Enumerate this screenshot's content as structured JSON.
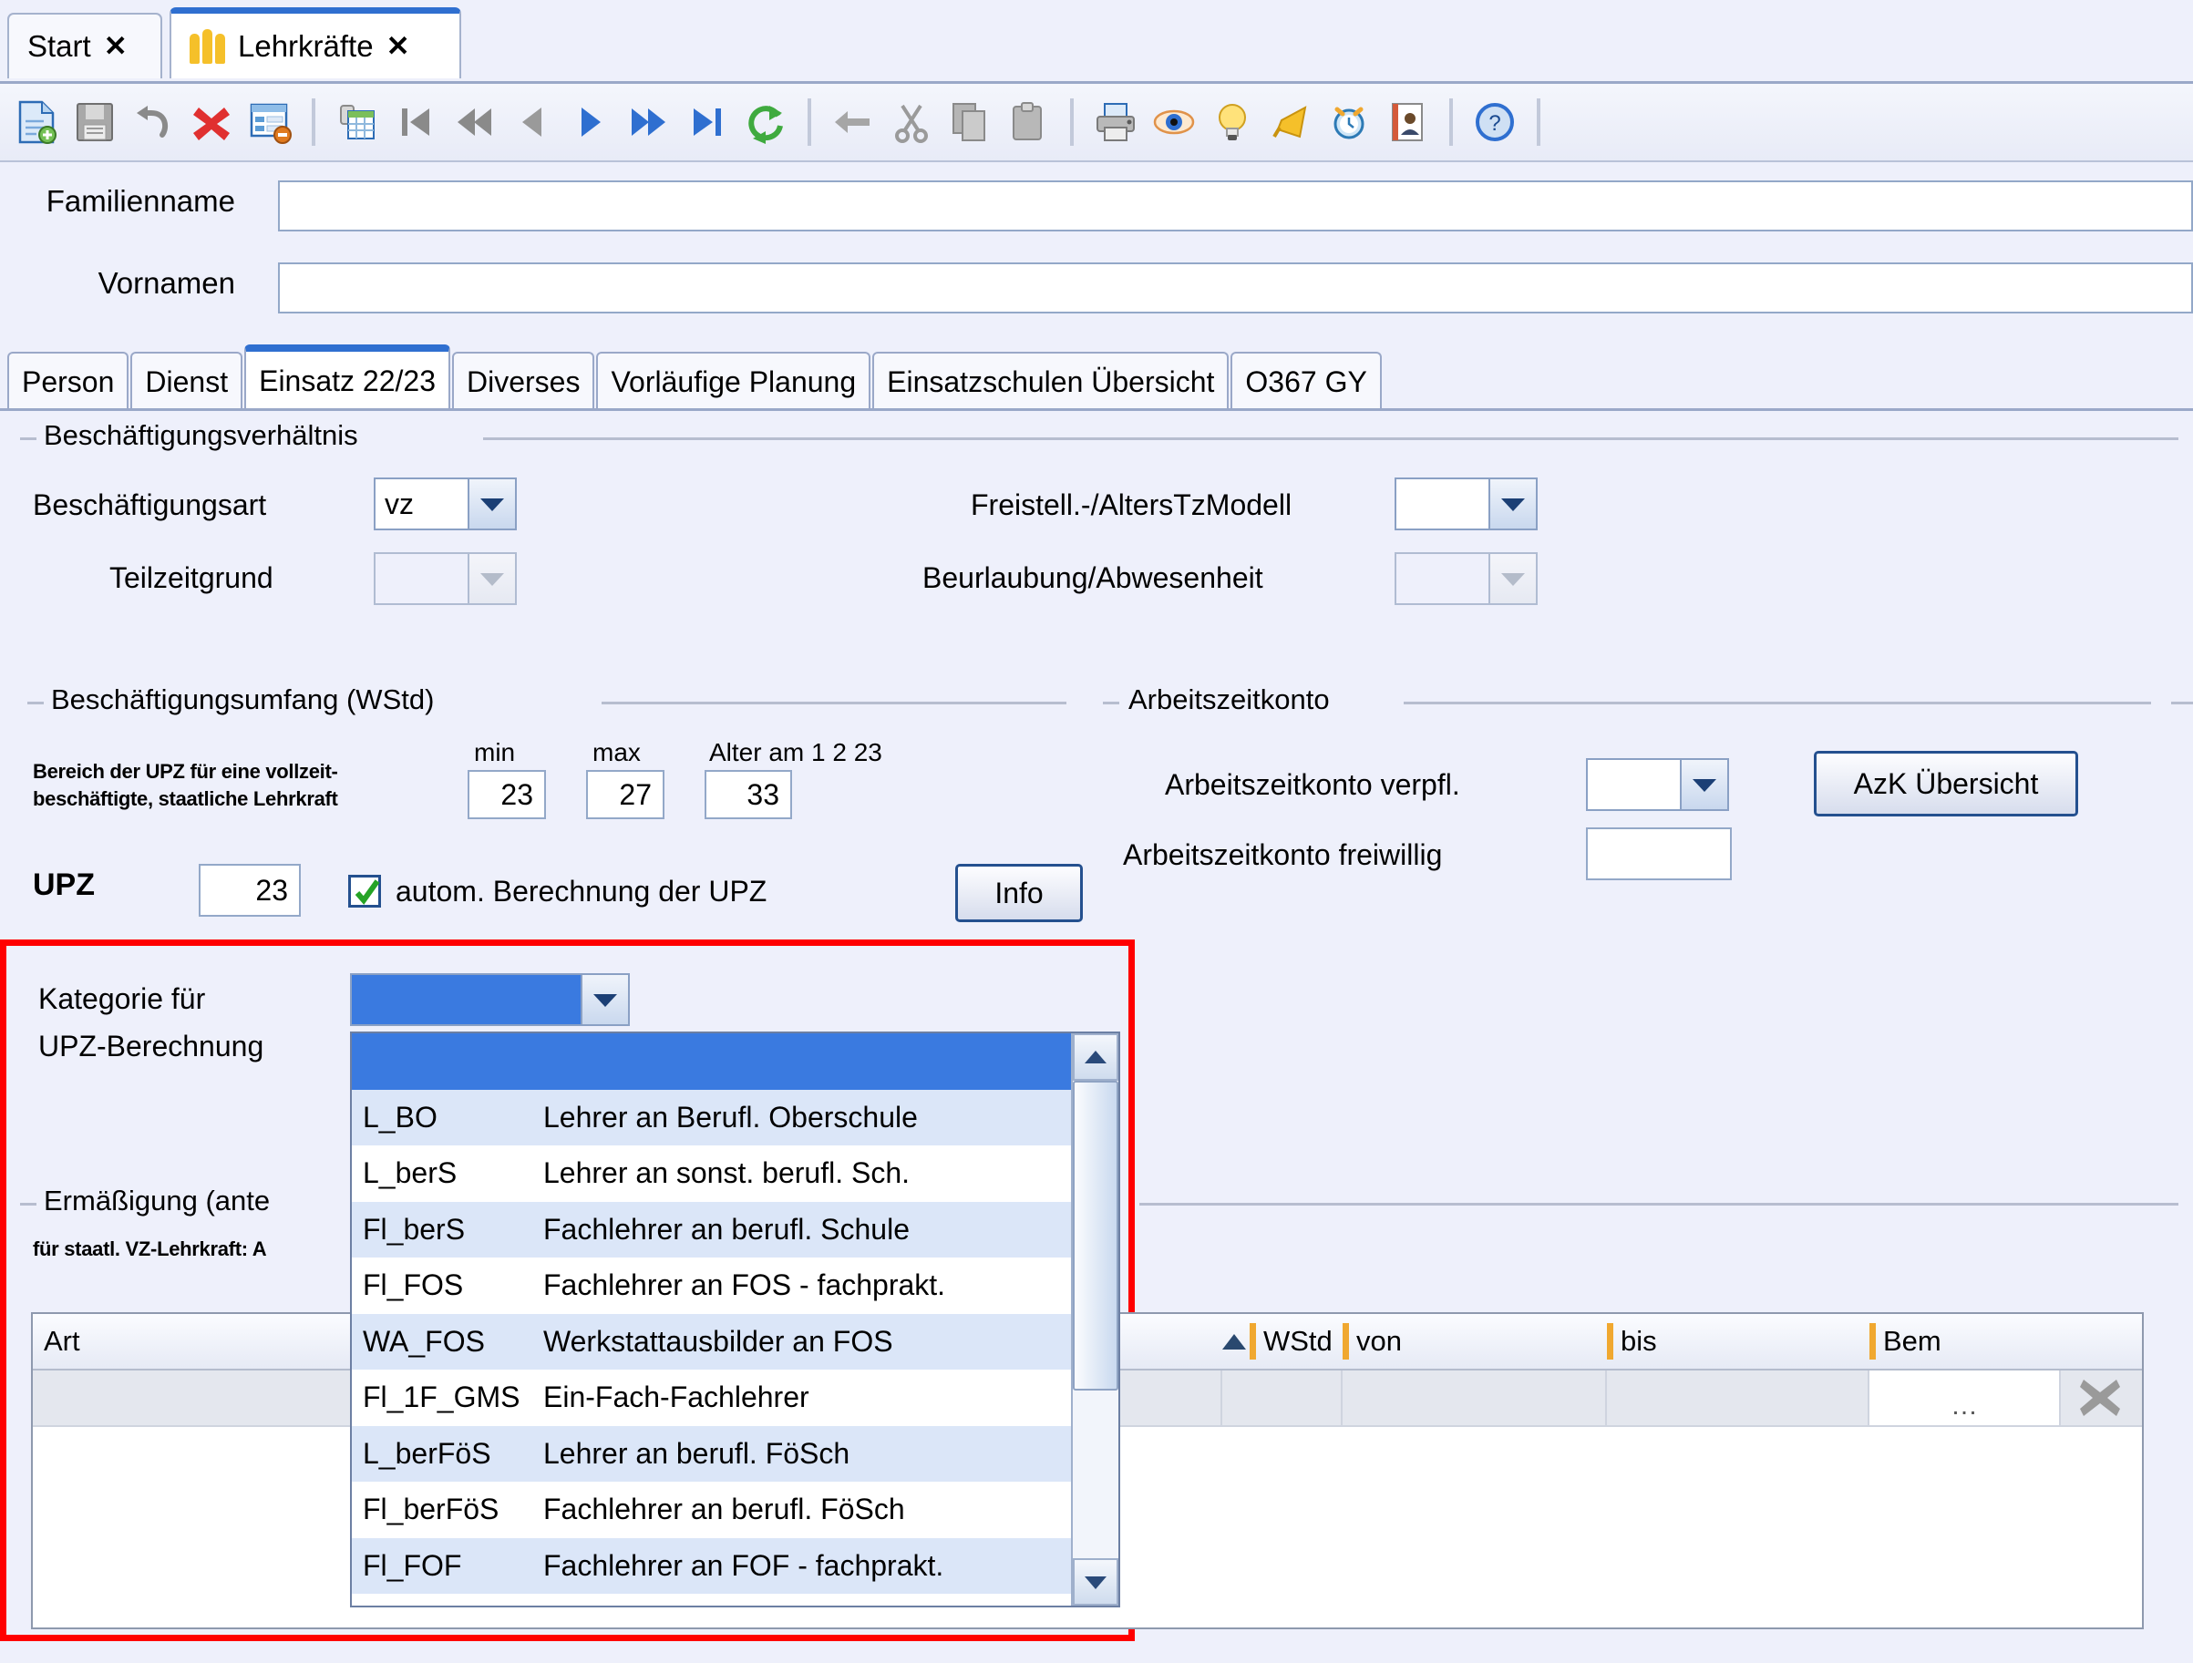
{
  "window_tabs": [
    {
      "label": "Start",
      "close": "✕",
      "icon": "none",
      "active": false
    },
    {
      "label": "Lehrkräfte",
      "close": "✕",
      "icon": "people-icon",
      "active": true
    }
  ],
  "toolbar": {
    "icons": [
      "new-document-icon",
      "save-icon",
      "undo-icon",
      "delete-icon",
      "form-remove-icon",
      "separator",
      "list-view-icon",
      "first-record-icon",
      "fast-rewind-icon",
      "previous-record-icon",
      "next-record-icon",
      "fast-forward-icon",
      "last-record-icon",
      "refresh-icon",
      "separator",
      "back-arrow-icon",
      "cut-icon",
      "copy-icon",
      "paste-icon",
      "separator",
      "print-icon",
      "preview-icon",
      "hint-icon",
      "announce-icon",
      "alarm-icon",
      "contact-icon",
      "separator",
      "help-icon",
      "separator"
    ]
  },
  "name_form": {
    "familienname_label": "Familienname",
    "familienname_value": "",
    "vornamen_label": "Vornamen",
    "vornamen_value": ""
  },
  "form_tabs": [
    {
      "label": "Person",
      "active": false
    },
    {
      "label": "Dienst",
      "active": false
    },
    {
      "label": "Einsatz 22/23",
      "active": true
    },
    {
      "label": "Diverses",
      "active": false
    },
    {
      "label": "Vorläufige Planung",
      "active": false
    },
    {
      "label": "Einsatzschulen Übersicht",
      "active": false
    },
    {
      "label": "O367 GY",
      "active": false
    }
  ],
  "beschaeftigungsverhaeltnis": {
    "title": "Beschäftigungsverhältnis",
    "beschaeftigungsart_label": "Beschäftigungsart",
    "beschaeftigungsart_value": "vz",
    "teilzeitgrund_label": "Teilzeitgrund",
    "teilzeitgrund_value": "",
    "freistell_label": "Freistell.-/AltersTzModell",
    "freistell_value": "",
    "beurlaubung_label": "Beurlaubung/Abwesenheit",
    "beurlaubung_value": ""
  },
  "beschaeftigungsumfang": {
    "title": "Beschäftigungsumfang (WStd)",
    "note_line1": "Bereich der UPZ für eine vollzeit-",
    "note_line2": "beschäftigte, staatliche Lehrkraft",
    "min_label": "min",
    "min_value": "23",
    "max_label": "max",
    "max_value": "27",
    "alter_label": "Alter am 1 2 23",
    "alter_value": "33",
    "upz_label": "UPZ",
    "upz_value": "23",
    "auto_checkbox_label": "autom. Berechnung der UPZ",
    "auto_checkbox_checked": true,
    "info_button": "Info"
  },
  "arbeitszeitkonto": {
    "title": "Arbeitszeitkonto",
    "verpfl_label": "Arbeitszeitkonto verpfl.",
    "verpfl_value": "",
    "freiwillig_label": "Arbeitszeitkonto freiwillig",
    "freiwillig_value": "",
    "azk_button": "AzK Übersicht"
  },
  "kategorie": {
    "label_line1": "Kategorie für",
    "label_line2": "UPZ-Berechnung",
    "selected_value": "",
    "options": [
      {
        "code": "",
        "text": "",
        "selected": true
      },
      {
        "code": "L_BO",
        "text": "Lehrer an Berufl. Oberschule",
        "selected": false
      },
      {
        "code": "L_berS",
        "text": "Lehrer an sonst. berufl. Sch.",
        "selected": false
      },
      {
        "code": "Fl_berS",
        "text": "Fachlehrer an berufl. Schule",
        "selected": false
      },
      {
        "code": "Fl_FOS",
        "text": "Fachlehrer an FOS - fachprakt.",
        "selected": false
      },
      {
        "code": "WA_FOS",
        "text": "Werkstattausbilder an FOS",
        "selected": false
      },
      {
        "code": "Fl_1F_GMS",
        "text": "Ein-Fach-Fachlehrer",
        "selected": false
      },
      {
        "code": "L_berFöS",
        "text": "Lehrer an berufl. FöSch",
        "selected": false
      },
      {
        "code": "Fl_berFöS",
        "text": "Fachlehrer an berufl. FöSch",
        "selected": false
      },
      {
        "code": "Fl_FOF",
        "text": "Fachlehrer an FOF - fachprakt.",
        "selected": false
      }
    ]
  },
  "ermaessigung": {
    "title": "Ermäßigung (ante",
    "subtitle": "für staatl. VZ-Lehrkraft: A"
  },
  "table": {
    "columns": [
      "Art",
      "WStd",
      "von",
      "bis",
      "Bem"
    ],
    "sort_indicator": "▲",
    "rows": [
      {
        "art": "",
        "wstd": "",
        "von": "",
        "bis": "",
        "bem": "",
        "dots": "…",
        "delete": "✕"
      }
    ]
  },
  "colors": {
    "background": "#eef0fb",
    "accent_blue": "#2f6fd0",
    "selection_blue": "#3a7ae0",
    "alt_row": "#dbe6f8",
    "highlight_red": "#ff0000",
    "column_sep_orange": "#f0a830"
  }
}
